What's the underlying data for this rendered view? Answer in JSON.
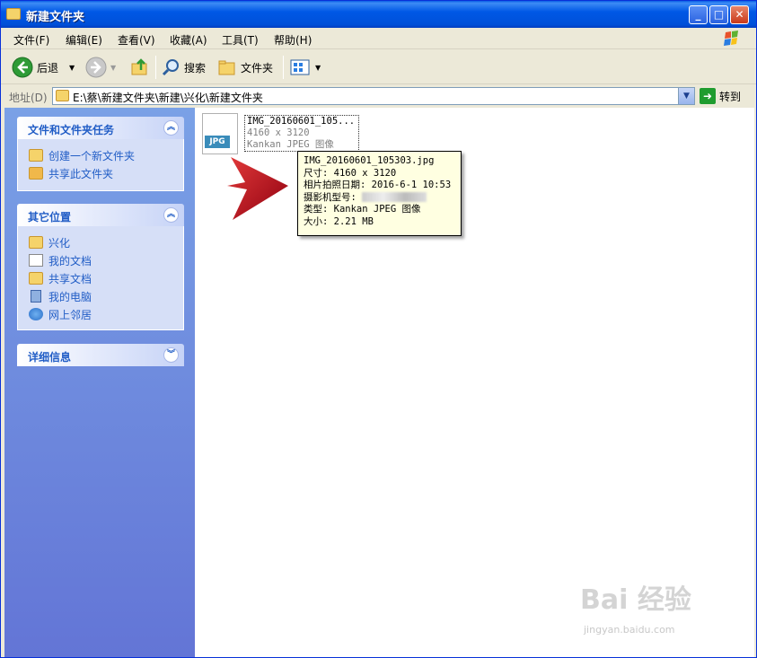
{
  "window": {
    "title": "新建文件夹"
  },
  "menu": [
    {
      "label": "文件(F)"
    },
    {
      "label": "编辑(E)"
    },
    {
      "label": "查看(V)"
    },
    {
      "label": "收藏(A)"
    },
    {
      "label": "工具(T)"
    },
    {
      "label": "帮助(H)"
    }
  ],
  "toolbar": {
    "back": "后退",
    "search": "搜索",
    "folders": "文件夹"
  },
  "address": {
    "label": "地址(D)",
    "path": "E:\\蔡\\新建文件夹\\新建\\兴化\\新建文件夹",
    "go": "转到"
  },
  "sidebar": {
    "tasks": {
      "title": "文件和文件夹任务",
      "items": [
        "创建一个新文件夹",
        "共享此文件夹"
      ]
    },
    "places": {
      "title": "其它位置",
      "items": [
        "兴化",
        "我的文档",
        "共享文档",
        "我的电脑",
        "网上邻居"
      ]
    },
    "details": {
      "title": "详细信息"
    }
  },
  "file": {
    "badge": "JPG",
    "name": "IMG_20160601_105...",
    "dims": "4160 x 3120",
    "type": "Kankan JPEG 图像"
  },
  "tooltip": {
    "name": "IMG_20160601_105303.jpg",
    "size_dims": "尺寸: 4160 x 3120",
    "date": "相片拍照日期: 2016-6-1 10:53",
    "camera": "摄影机型号:",
    "type": "类型: Kankan JPEG 图像",
    "filesize": "大小: 2.21 MB"
  },
  "watermark": {
    "main": "Bai 经验",
    "url": "jingyan.baidu.com"
  },
  "colors": {
    "accent": "#215dc6",
    "title_bar": "#0058e6",
    "arrow": "#c4001a"
  }
}
